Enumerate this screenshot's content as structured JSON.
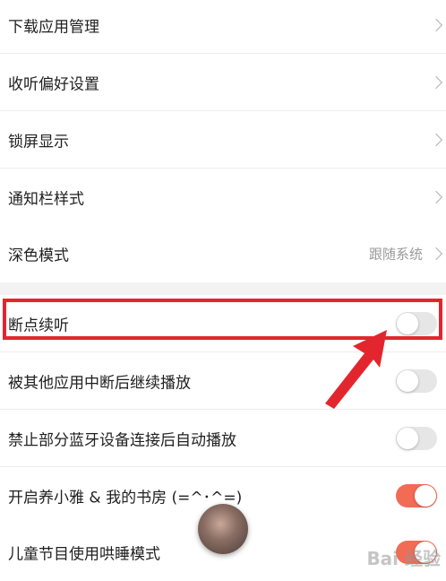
{
  "settings": {
    "group1": [
      {
        "label": "下载应用管理"
      },
      {
        "label": "收听偏好设置"
      },
      {
        "label": "锁屏显示"
      },
      {
        "label": "通知栏样式"
      },
      {
        "label": "深色模式",
        "value": "跟随系统"
      }
    ],
    "group2": [
      {
        "label": "断点续听",
        "toggle": "off"
      },
      {
        "label": "被其他应用中断后继续播放",
        "toggle": "off"
      },
      {
        "label": "禁止部分蓝牙设备连接后自动播放",
        "toggle": "off"
      },
      {
        "label": "开启养小雅 & 我的书房 (=^･^=)",
        "toggle": "on"
      },
      {
        "label": "儿童节目使用哄睡模式",
        "toggle": "on"
      }
    ]
  },
  "colors": {
    "highlight": "#e3262e",
    "toggle_on": "#f26b55",
    "toggle_off": "#e6e6e6"
  },
  "watermark": "Bai 经验"
}
